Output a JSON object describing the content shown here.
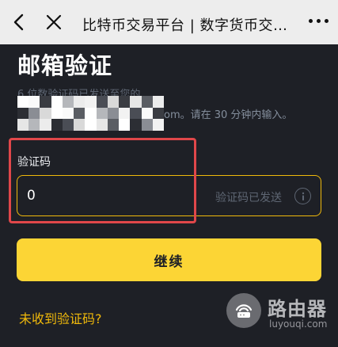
{
  "navbar": {
    "title": "比特币交易平台 | 数字货币交…",
    "back_icon": "chevron-left-icon",
    "close_icon": "close-icon",
    "more_icon": "more-dots-icon"
  },
  "verify": {
    "heading": "邮箱验证",
    "sent_prefix": "6 位数验证码已发送至您的",
    "sent_suffix": "om。请在 30 分钟内输入。"
  },
  "code_field": {
    "label": "验证码",
    "value": "0",
    "status": "验证码已发送",
    "info_icon": "info-icon"
  },
  "actions": {
    "continue_label": "继续",
    "resend_label": "未收到验证码?"
  },
  "watermark": {
    "name": "路由器",
    "url": "luyouqi.com"
  },
  "colors": {
    "background": "#1e2026",
    "accent": "#fcd535",
    "border_accent": "#f0b90b",
    "highlight": "#e0474a"
  }
}
